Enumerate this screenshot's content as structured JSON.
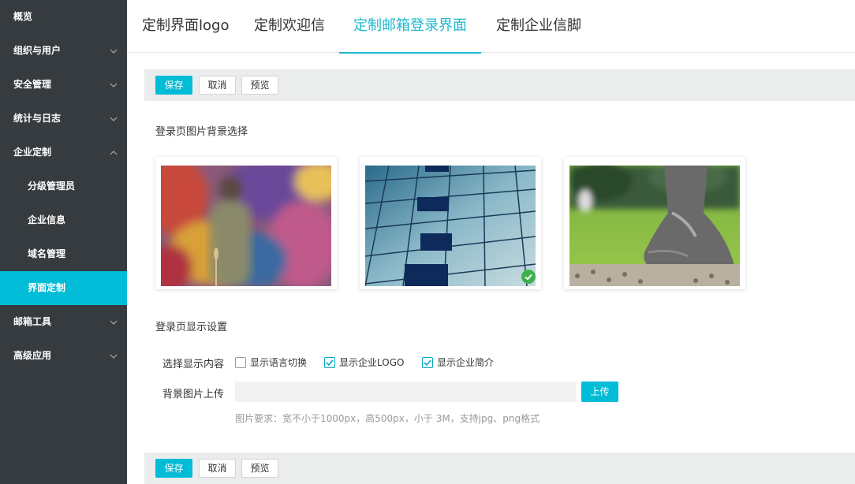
{
  "sidebar": {
    "items": [
      {
        "label": "概览",
        "chevron": "none",
        "sub": false,
        "active": false
      },
      {
        "label": "组织与用户",
        "chevron": "down",
        "sub": false,
        "active": false
      },
      {
        "label": "安全管理",
        "chevron": "down",
        "sub": false,
        "active": false
      },
      {
        "label": "统计与日志",
        "chevron": "down",
        "sub": false,
        "active": false
      },
      {
        "label": "企业定制",
        "chevron": "up",
        "sub": false,
        "active": false
      },
      {
        "label": "分级管理员",
        "chevron": "none",
        "sub": true,
        "active": false
      },
      {
        "label": "企业信息",
        "chevron": "none",
        "sub": true,
        "active": false
      },
      {
        "label": "域名管理",
        "chevron": "none",
        "sub": true,
        "active": false
      },
      {
        "label": "界面定制",
        "chevron": "none",
        "sub": true,
        "active": true
      },
      {
        "label": "邮箱工具",
        "chevron": "down",
        "sub": false,
        "active": false
      },
      {
        "label": "高级应用",
        "chevron": "down",
        "sub": false,
        "active": false
      }
    ]
  },
  "tabs": [
    {
      "label": "定制界面logo",
      "active": false
    },
    {
      "label": "定制欢迎信",
      "active": false
    },
    {
      "label": "定制邮箱登录界面",
      "active": true
    },
    {
      "label": "定制企业信脚",
      "active": false
    }
  ],
  "toolbar": {
    "save_label": "保存",
    "cancel_label": "取消",
    "preview_label": "预览"
  },
  "background_section": {
    "title": "登录页图片背景选择",
    "options": [
      {
        "name": "graffiti-wall",
        "selected": false
      },
      {
        "name": "glass-building",
        "selected": true
      },
      {
        "name": "stone-foot-statue",
        "selected": false
      }
    ]
  },
  "display_section": {
    "title": "登录页显示设置",
    "content_label": "选择显示内容",
    "checkboxes": [
      {
        "label": "显示语言切换",
        "checked": false
      },
      {
        "label": "显示企业LOGO",
        "checked": true
      },
      {
        "label": "显示企业简介",
        "checked": true
      }
    ],
    "upload_label": "背景图片上传",
    "upload_value": "",
    "upload_button": "上传",
    "hint": "图片要求：宽不小于1000px，高500px，小于 3M，支持jpg、png格式"
  },
  "colors": {
    "sidebar_bg": "#363b3f",
    "accent": "#00bcd6",
    "toolbar_bg": "#ebedec",
    "success": "#3fb14c"
  }
}
